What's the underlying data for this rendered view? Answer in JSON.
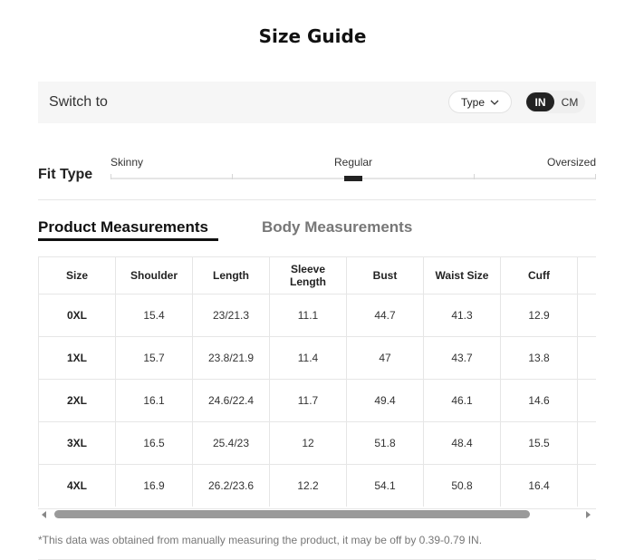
{
  "title": "Size Guide",
  "switch": {
    "label": "Switch to",
    "type_label": "Type",
    "units": [
      "IN",
      "CM"
    ],
    "selected_unit": "IN"
  },
  "fit": {
    "title": "Fit Type",
    "options": [
      "Skinny",
      "Regular",
      "Oversized"
    ],
    "selected": "Regular"
  },
  "tabs": {
    "active": "Product Measurements",
    "inactive": "Body Measurements"
  },
  "table": {
    "headers": [
      "Size",
      "Shoulder",
      "Length",
      "Sleeve Length",
      "Bust",
      "Waist Size",
      "Cuff",
      ""
    ],
    "rows": [
      [
        "0XL",
        "15.4",
        "23/21.3",
        "11.1",
        "44.7",
        "41.3",
        "12.9",
        ""
      ],
      [
        "1XL",
        "15.7",
        "23.8/21.9",
        "11.4",
        "47",
        "43.7",
        "13.8",
        ""
      ],
      [
        "2XL",
        "16.1",
        "24.6/22.4",
        "11.7",
        "49.4",
        "46.1",
        "14.6",
        ""
      ],
      [
        "3XL",
        "16.5",
        "25.4/23",
        "12",
        "51.8",
        "48.4",
        "15.5",
        ""
      ],
      [
        "4XL",
        "16.9",
        "26.2/23.6",
        "12.2",
        "54.1",
        "50.8",
        "16.4",
        ""
      ]
    ]
  },
  "note": "*This data was obtained from manually measuring the product, it may be off by 0.39-0.79 IN.",
  "colors": {
    "accent": "#222222",
    "bar_bg": "#f6f6f6",
    "muted_text": "#777777"
  },
  "icons": {
    "type_dropdown": "chevron-down-icon",
    "scroll_left": "triangle-left-icon",
    "scroll_right": "triangle-right-icon"
  }
}
